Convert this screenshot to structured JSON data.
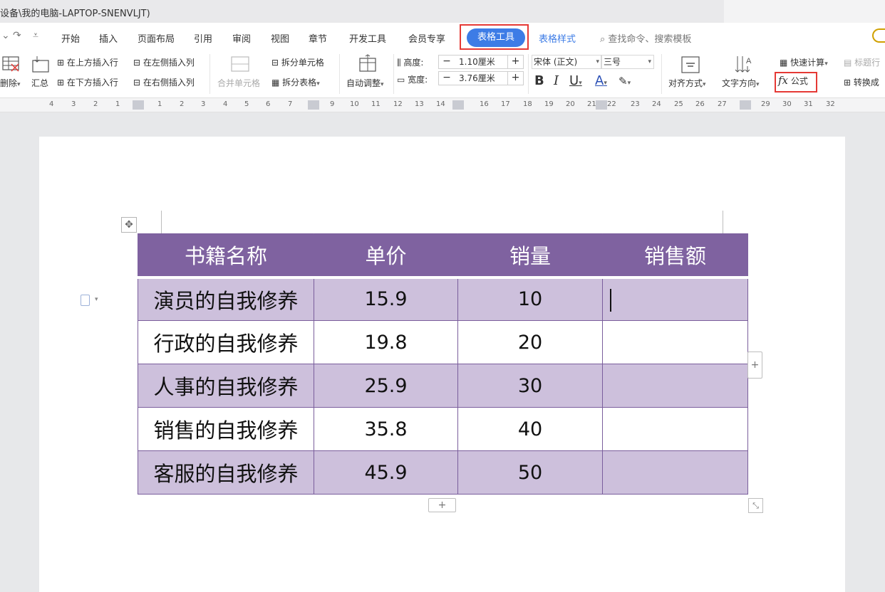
{
  "window": {
    "title": "设备\\我的电脑-LAPTOP-SNENVLJT)"
  },
  "menu": {
    "tabs": [
      "开始",
      "插入",
      "页面布局",
      "引用",
      "审阅",
      "视图",
      "章节",
      "开发工具",
      "会员专享"
    ],
    "active_tab": "表格工具",
    "secondary_tab": "表格样式",
    "search_placeholder": "查找命令、搜索模板"
  },
  "ribbon": {
    "delete": "删除",
    "summary": "汇总",
    "insert_above": "在上方插入行",
    "insert_below": "在下方插入行",
    "insert_left": "在左侧插入列",
    "insert_right": "在右侧插入列",
    "merge_cells": "合并单元格",
    "split_cells": "拆分单元格",
    "split_table": "拆分表格",
    "auto_fit": "自动调整",
    "height_label": "高度:",
    "height_value": "1.10厘米",
    "width_label": "宽度:",
    "width_value": "3.76厘米",
    "minus": "−",
    "plus": "+",
    "font_name": "宋体 (正文)",
    "font_size": "三号",
    "bold": "B",
    "italic": "I",
    "underline": "U",
    "font_color": "A",
    "align": "对齐方式",
    "text_direction": "文字方向",
    "quick_calc": "快速计算",
    "title_row": "标题行",
    "formula": "公式",
    "formula_prefix": "fx",
    "convert": "转换成"
  },
  "ruler": {
    "left_numbers": [
      "4",
      "3",
      "2",
      "1"
    ],
    "right_numbers": [
      "1",
      "2",
      "3",
      "4",
      "5",
      "6",
      "7",
      "9",
      "10",
      "11",
      "12",
      "13",
      "14",
      "16",
      "17",
      "18",
      "19",
      "20",
      "21",
      "22",
      "23",
      "24",
      "25",
      "26",
      "27",
      "29",
      "30",
      "31",
      "32"
    ]
  },
  "table": {
    "headers": [
      "书籍名称",
      "单价",
      "销量",
      "销售额"
    ],
    "rows": [
      [
        "演员的自我修养",
        "15.9",
        "10",
        ""
      ],
      [
        "行政的自我修养",
        "19.8",
        "20",
        ""
      ],
      [
        "人事的自我修养",
        "25.9",
        "30",
        ""
      ],
      [
        "销售的自我修养",
        "35.8",
        "40",
        ""
      ],
      [
        "客服的自我修养",
        "45.9",
        "50",
        ""
      ]
    ]
  },
  "controls": {
    "add": "+",
    "move": "✥",
    "resize": "⤡"
  },
  "colors": {
    "accent": "#3d7ce6",
    "header_purple": "#7f62a0",
    "band_purple": "#cdc0dc",
    "highlight": "#e53935"
  }
}
